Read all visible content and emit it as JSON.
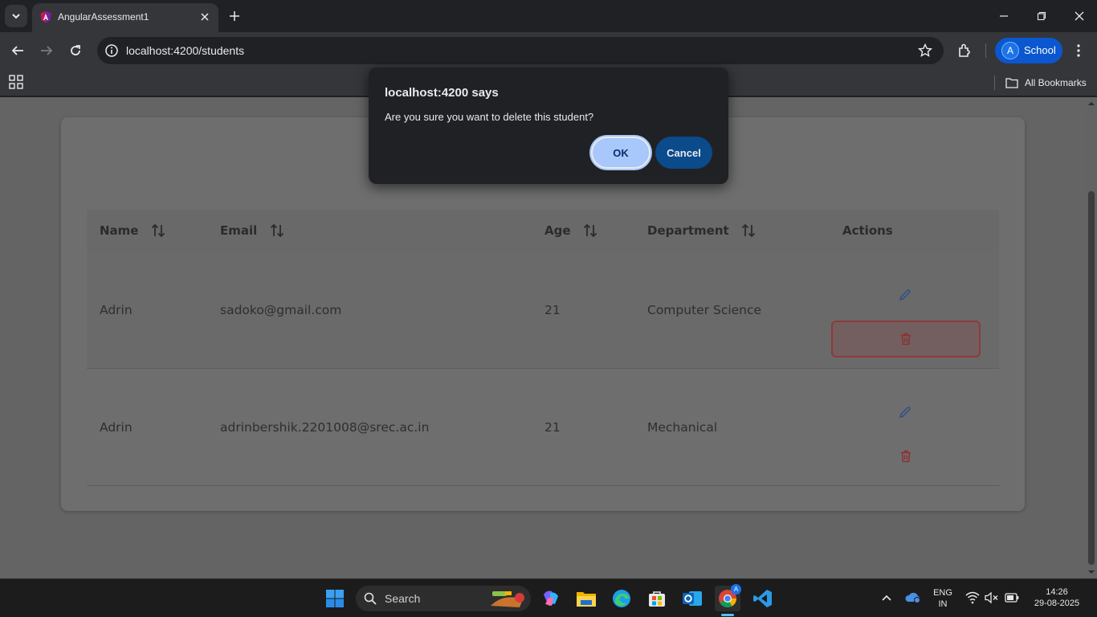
{
  "browser": {
    "tab_title": "AngularAssessment1",
    "url": "localhost:4200/students",
    "profile_initial": "A",
    "profile_name": "School",
    "all_bookmarks": "All Bookmarks"
  },
  "dialog": {
    "title": "localhost:4200 says",
    "message": "Are you sure you want to delete this student?",
    "ok_label": "OK",
    "cancel_label": "Cancel"
  },
  "table": {
    "columns": [
      "Name",
      "Email",
      "Age",
      "Department",
      "Actions"
    ],
    "rows": [
      {
        "name": "Adrin",
        "email": "sadoko@gmail.com",
        "age": "21",
        "department": "Computer Science"
      },
      {
        "name": "Adrin",
        "email": "adrinbershik.2201008@srec.ac.in",
        "age": "21",
        "department": "Mechanical"
      }
    ]
  },
  "taskbar": {
    "search_label": "Search",
    "lang_top": "ENG",
    "lang_bottom": "IN",
    "time": "14:26",
    "date": "29-08-2025",
    "chrome_badge": "A"
  },
  "colors": {
    "accent": "#0b57d0",
    "dialog_ok": "#a8c7fa",
    "dialog_cancel": "#0b4a8b",
    "edit_icon": "#2f4f86",
    "delete_icon": "#8e2f2f"
  }
}
